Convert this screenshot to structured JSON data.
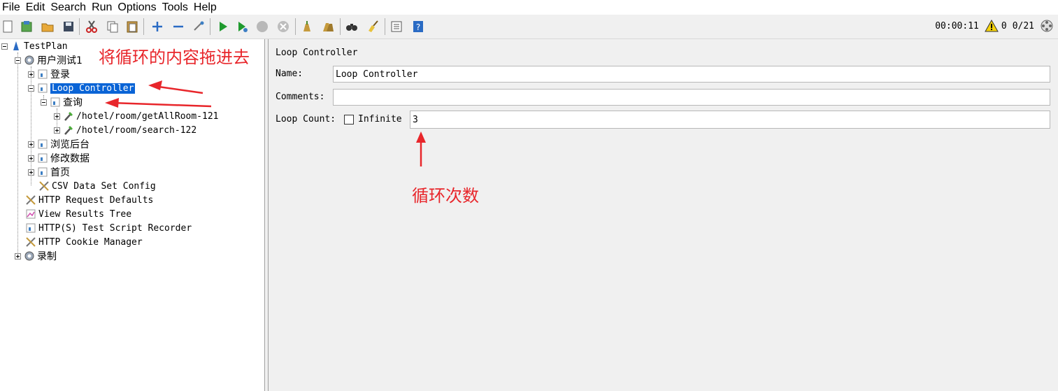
{
  "menu": [
    "File",
    "Edit",
    "Search",
    "Run",
    "Options",
    "Tools",
    "Help"
  ],
  "status": {
    "elapsed": "00:00:11",
    "warnings": "0",
    "threads": "0/21"
  },
  "tree": {
    "root": "TestPlan",
    "thread_group": "用户测试1",
    "login": "登录",
    "loop_controller": "Loop Controller",
    "query": "查询",
    "sampler1": "/hotel/room/getAllRoom-121",
    "sampler2": "/hotel/room/search-122",
    "browse_backend": "浏览后台",
    "modify_data": "修改数据",
    "home": "首页",
    "csv": "CSV Data Set Config",
    "http_defaults": "HTTP Request Defaults",
    "results_tree": "View Results Tree",
    "recorder": "HTTP(S) Test Script Recorder",
    "cookie": "HTTP Cookie Manager",
    "record": "录制"
  },
  "panel": {
    "title": "Loop Controller",
    "name_label": "Name:",
    "name_value": "Loop Controller",
    "comments_label": "Comments:",
    "comments_value": "",
    "loop_label": "Loop Count:",
    "infinite_label": "Infinite",
    "loop_value": "3"
  },
  "annotations": {
    "drag_hint": "将循环的内容拖进去",
    "loop_hint": "循环次数"
  },
  "colors": {
    "selection": "#0a64d6",
    "annotation": "#e8262b"
  }
}
